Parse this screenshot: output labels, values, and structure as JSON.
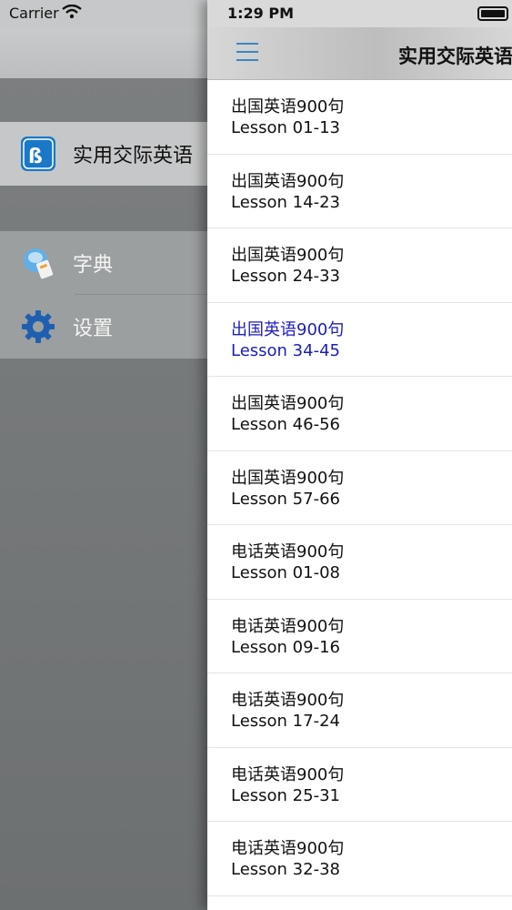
{
  "drawer": {
    "carrier": "Carrier",
    "items": [
      {
        "label": "实用交际英语",
        "icon": "app-logo-icon"
      },
      {
        "label": "字典",
        "icon": "dictionary-icon"
      },
      {
        "label": "设置",
        "icon": "gear-icon"
      }
    ]
  },
  "main": {
    "time": "1:29 PM",
    "title": "实用交际英语",
    "lessons": [
      {
        "title": "出国英语900句",
        "subtitle": "Lesson 01-13"
      },
      {
        "title": "出国英语900句",
        "subtitle": "Lesson 14-23"
      },
      {
        "title": "出国英语900句",
        "subtitle": "Lesson 24-33"
      },
      {
        "title": "出国英语900句",
        "subtitle": "Lesson 34-45",
        "selected": true
      },
      {
        "title": "出国英语900句",
        "subtitle": "Lesson 46-56"
      },
      {
        "title": "出国英语900句",
        "subtitle": "Lesson 57-66"
      },
      {
        "title": "电话英语900句",
        "subtitle": "Lesson 01-08"
      },
      {
        "title": "电话英语900句",
        "subtitle": "Lesson 09-16"
      },
      {
        "title": "电话英语900句",
        "subtitle": "Lesson 17-24"
      },
      {
        "title": "电话英语900句",
        "subtitle": "Lesson 25-31"
      },
      {
        "title": "电话英语900句",
        "subtitle": "Lesson 32-38"
      }
    ]
  },
  "colors": {
    "accent": "#3a86c8",
    "selected_text": "#1d1dbb"
  }
}
